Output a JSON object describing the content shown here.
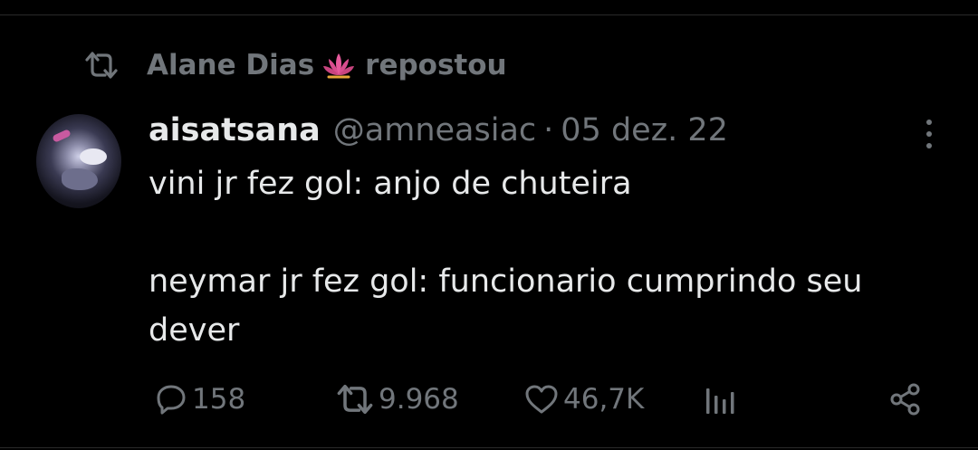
{
  "repost": {
    "reposter_name": "Alane Dias",
    "reposter_emoji_icon": "lotus-icon",
    "action_label": "repostou"
  },
  "tweet": {
    "display_name": "aisatsana",
    "handle": "@amneasiac",
    "separator": "·",
    "date": "05 dez. 22",
    "text": "vini jr fez gol: anjo de chuteira\n\nneymar jr fez gol: funcionario cumprindo seu\ndever"
  },
  "actions": {
    "replies": "158",
    "reposts": "9.968",
    "likes": "46,7K"
  },
  "colors": {
    "background": "#000000",
    "primary_text": "#e7e9ea",
    "secondary_text": "#71767b",
    "lotus_pink": "#e75a9c"
  }
}
